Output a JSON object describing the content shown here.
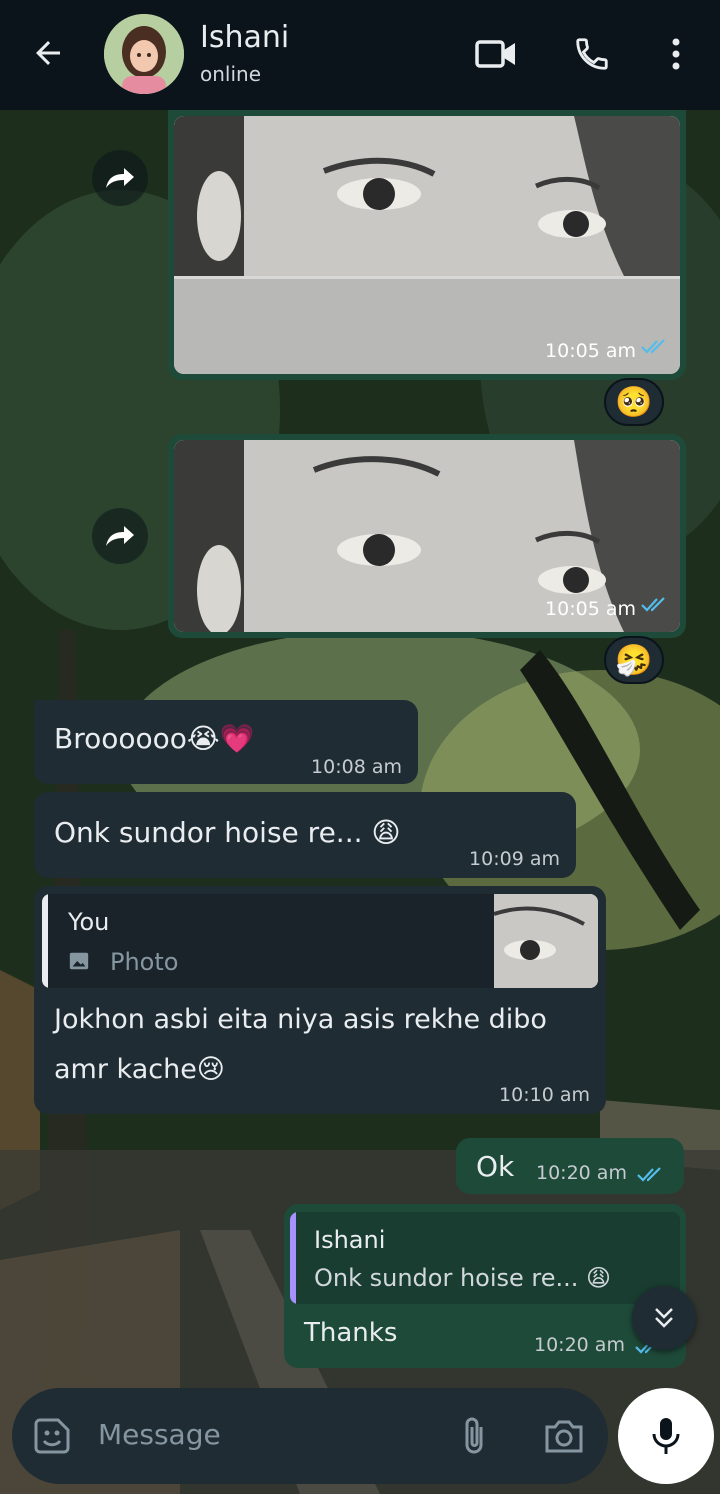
{
  "header": {
    "contact_name": "Ishani",
    "status": "online"
  },
  "messages": [
    {
      "type": "forwarded-image",
      "direction": "out",
      "time": "10:05 am",
      "reaction": "🥺"
    },
    {
      "type": "forwarded-image",
      "direction": "out",
      "time": "10:05 am",
      "reaction": "🤧"
    },
    {
      "type": "text",
      "direction": "in",
      "text": "Broooooo😭💗",
      "time": "10:08 am"
    },
    {
      "type": "text",
      "direction": "in",
      "text": "Onk sundor hoise re... 😩",
      "time": "10:09 am"
    },
    {
      "type": "reply",
      "direction": "in",
      "quote_author": "You",
      "quote_text": "Photo",
      "line1": "Jokhon asbi eita niya asis rekhe dibo",
      "line2": "amr kache😢",
      "time": "10:10 am"
    },
    {
      "type": "text",
      "direction": "out",
      "text": "Ok",
      "time": "10:20 am"
    },
    {
      "type": "reply",
      "direction": "out",
      "quote_author": "Ishani",
      "quote_text": "Onk sundor hoise re... 😩",
      "text": "Thanks",
      "time": "10:20 am"
    }
  ],
  "composer": {
    "placeholder": "Message"
  },
  "colors": {
    "header_bg": "#0b141a",
    "incoming_bubble": "#1f2c34",
    "outgoing_bubble": "#1e4a39",
    "read_ticks": "#53bdeb"
  }
}
